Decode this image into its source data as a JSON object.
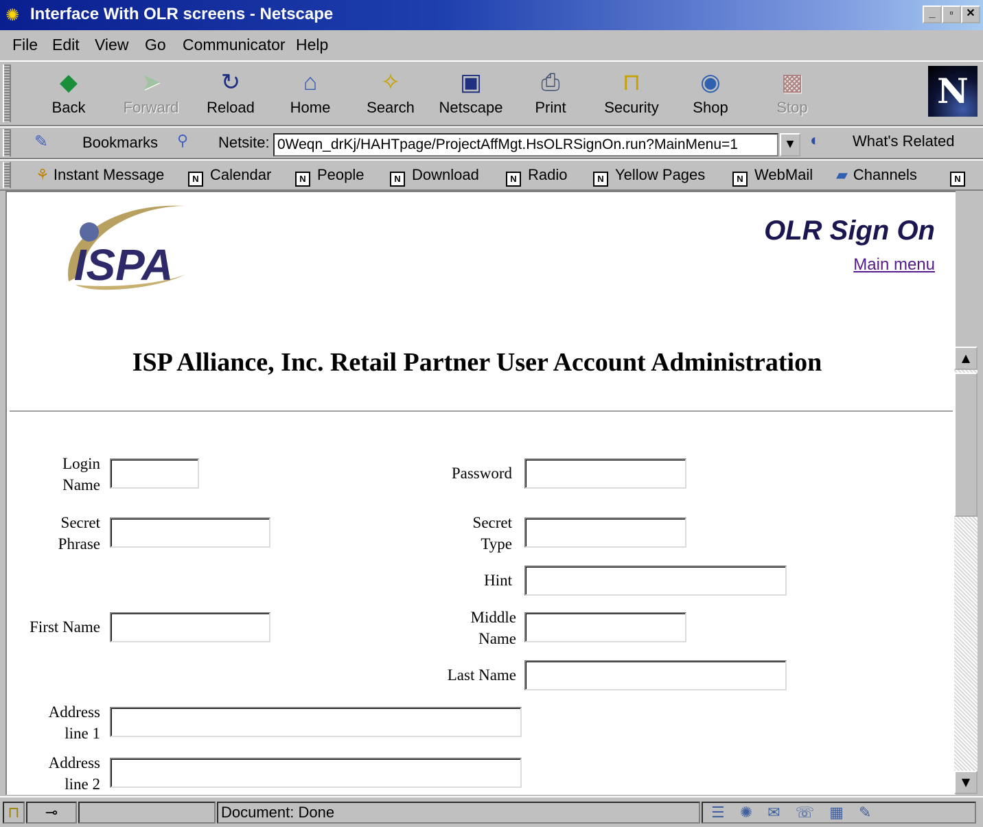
{
  "window": {
    "title": "Interface With OLR screens - Netscape"
  },
  "menubar": [
    "File",
    "Edit",
    "View",
    "Go",
    "Communicator",
    "Help"
  ],
  "nav_buttons": [
    {
      "label": "Back",
      "icon": "back-arrow-icon",
      "glyph": "◆"
    },
    {
      "label": "Forward",
      "icon": "forward-arrow-icon",
      "glyph": "➤"
    },
    {
      "label": "Reload",
      "icon": "reload-icon",
      "glyph": "↻"
    },
    {
      "label": "Home",
      "icon": "home-icon",
      "glyph": "⌂"
    },
    {
      "label": "Search",
      "icon": "search-icon",
      "glyph": "✧"
    },
    {
      "label": "Netscape",
      "icon": "my-netscape-icon",
      "glyph": "▣"
    },
    {
      "label": "Print",
      "icon": "printer-icon",
      "glyph": "⎙"
    },
    {
      "label": "Security",
      "icon": "lock-icon",
      "glyph": "🔒"
    },
    {
      "label": "Shop",
      "icon": "shopping-bag-icon",
      "glyph": "◉"
    },
    {
      "label": "Stop",
      "icon": "stop-icon",
      "glyph": "▩"
    }
  ],
  "location": {
    "bookmarks_label": "Bookmarks",
    "netsite_label": "Netsite:",
    "url": "0Weqn_drKj/HAHTpage/ProjectAffMgt.HsOLRSignOn.run?MainMenu=1",
    "whats_related": "What's Related"
  },
  "personal_toolbar": [
    "Instant Message",
    "Calendar",
    "People",
    "Download",
    "Radio",
    "Yellow Pages",
    "WebMail",
    "Channels"
  ],
  "page": {
    "logo_text": "ISPA",
    "title": "OLR Sign On",
    "main_menu_link": "Main menu",
    "heading": "ISP Alliance, Inc. Retail Partner User Account Administration"
  },
  "form": {
    "login_name": "Login\nName",
    "password": "Password",
    "secret_phrase": "Secret\nPhrase",
    "secret_type": "Secret\nType",
    "hint": "Hint",
    "first_name": "First Name",
    "middle_name": "Middle\nName",
    "last_name": "Last Name",
    "address_line_1": "Address\nline 1",
    "address_line_2": "Address\nline 2"
  },
  "status": {
    "text": "Document: Done"
  }
}
